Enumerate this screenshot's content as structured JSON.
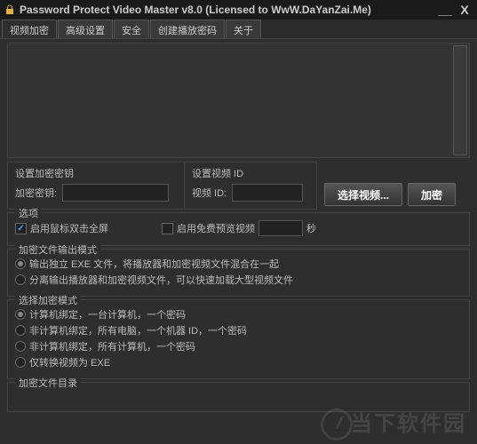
{
  "window": {
    "title": "Password Protect Video Master v8.0 (Licensed to WwW.DaYanZai.Me)"
  },
  "tabs": [
    "视频加密",
    "高级设置",
    "安全",
    "创建播放密码",
    "关于"
  ],
  "key_section": {
    "title": "设置加密密钥",
    "label": "加密密钥:"
  },
  "id_section": {
    "title": "设置视频 ID",
    "label": "视频 ID:"
  },
  "buttons": {
    "select_video": "选择视频...",
    "encrypt": "加密"
  },
  "options": {
    "title": "选项",
    "double_click": "启用鼠标双击全屏",
    "free_preview": "启用免费预览视频",
    "seconds_unit": "秒"
  },
  "output_mode": {
    "title": "加密文件输出模式",
    "opt1": "输出独立 EXE 文件，将播放器和加密视频文件混合在一起",
    "opt2": "分离输出播放器和加密视频文件，可以快速加载大型视频文件"
  },
  "encrypt_mode": {
    "title": "选择加密模式",
    "opt1": "计算机绑定，一台计算机，一个密码",
    "opt2": "非计算机绑定，所有电脑，一个机器 ID，一个密码",
    "opt3": "非计算机绑定，所有计算机，一个密码",
    "opt4": "仅转换视频为 EXE"
  },
  "output_dir": {
    "title": "加密文件目录"
  },
  "watermark": "当下软件园"
}
